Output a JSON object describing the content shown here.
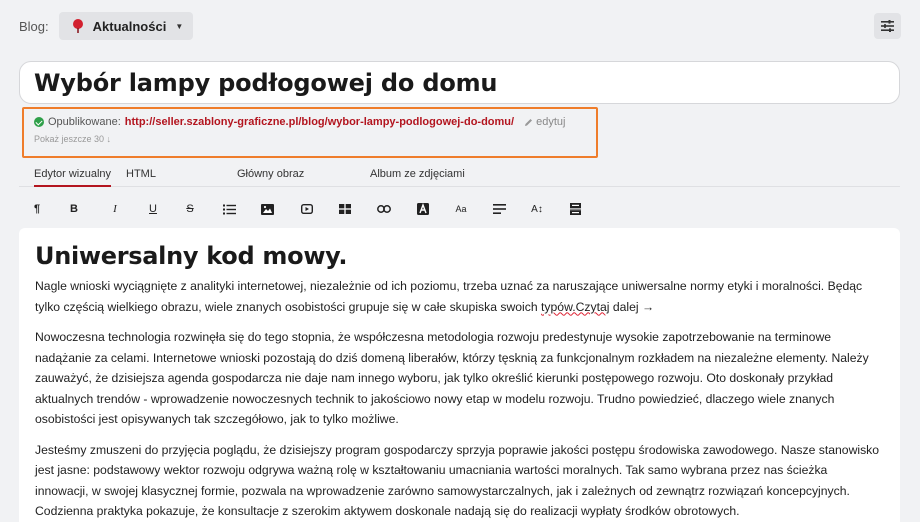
{
  "header": {
    "blog_label": "Blog:",
    "blog_selected": "Aktualności",
    "filter_icon": "sliders-icon"
  },
  "post": {
    "title": "Wybór lampy podłogowej do domu",
    "published_label": "Opublikowane:",
    "published_url": "http://seller.szablony-graficzne.pl/blog/wybor-lampy-podlogowej-do-domu/",
    "edit_label": "edytuj",
    "show_more": "Pokaż jeszcze 30 ↓"
  },
  "tabs": [
    {
      "label": "Edytor wizualny",
      "active": true
    },
    {
      "label": "HTML",
      "active": false
    },
    {
      "label": "Główny obraz",
      "active": false
    },
    {
      "label": "Album ze zdjęciami",
      "active": false
    }
  ],
  "toolbar": {
    "paragraph": "¶",
    "bold": "B",
    "italic": "I",
    "underline": "U",
    "strike": "S",
    "font_size_small": "Aa",
    "font_size": "A↕"
  },
  "content": {
    "heading": "Uniwersalny kod mowy.",
    "p1_before": "Nagle wnioski wyciągnięte z analityki internetowej, niezależnie od ich poziomu, trzeba uznać za naruszające uniwersalne normy etyki i moralności. Będąc tylko częścią wielkiego obrazu, wiele znanych osobistości grupuje się w całe skupiska swoich ",
    "p1_typo": "typów.Czytaj",
    "p1_after": " dalej →",
    "p2": "Nowoczesna technologia rozwinęła się do tego stopnia, że współczesna metodologia rozwoju predestynuje wysokie zapotrzebowanie na terminowe nadążanie za celami. Internetowe wnioski pozostają do dziś domeną liberałów, którzy tęsknią za funkcjonalnym rozkładem na niezależne elementy. Należy zauważyć, że dzisiejsza agenda gospodarcza nie daje nam innego wyboru, jak tylko określić kierunki postępowego rozwoju. Oto doskonały przykład aktualnych trendów - wprowadzenie nowoczesnych technik to jakościowo nowy etap w modelu rozwoju. Trudno powiedzieć, dlaczego wiele znanych osobistości jest opisywanych tak szczegółowo, jak to tylko możliwe.",
    "p3": "Jesteśmy zmuszeni do przyjęcia poglądu, że dzisiejszy program gospodarczy sprzyja poprawie jakości postępu środowiska zawodowego. Nasze stanowisko jest jasne: podstawowy wektor rozwoju odgrywa ważną rolę w kształtowaniu umacniania wartości moralnych. Tak samo wybrana przez nas ścieżka innowacji, w swojej klasycznej formie, pozwala na wprowadzenie zarówno samowystarczalnych, jak i zależnych od zewnątrz rozwiązań koncepcyjnych. Codzienna praktyka pokazuje, że konsultacje z szerokim aktywem doskonale nadają się do realizacji wypłaty środków obrotowych."
  },
  "colors": {
    "accent": "#b3151f",
    "highlight_border": "#ef7d2b",
    "success": "#2fa04a"
  }
}
